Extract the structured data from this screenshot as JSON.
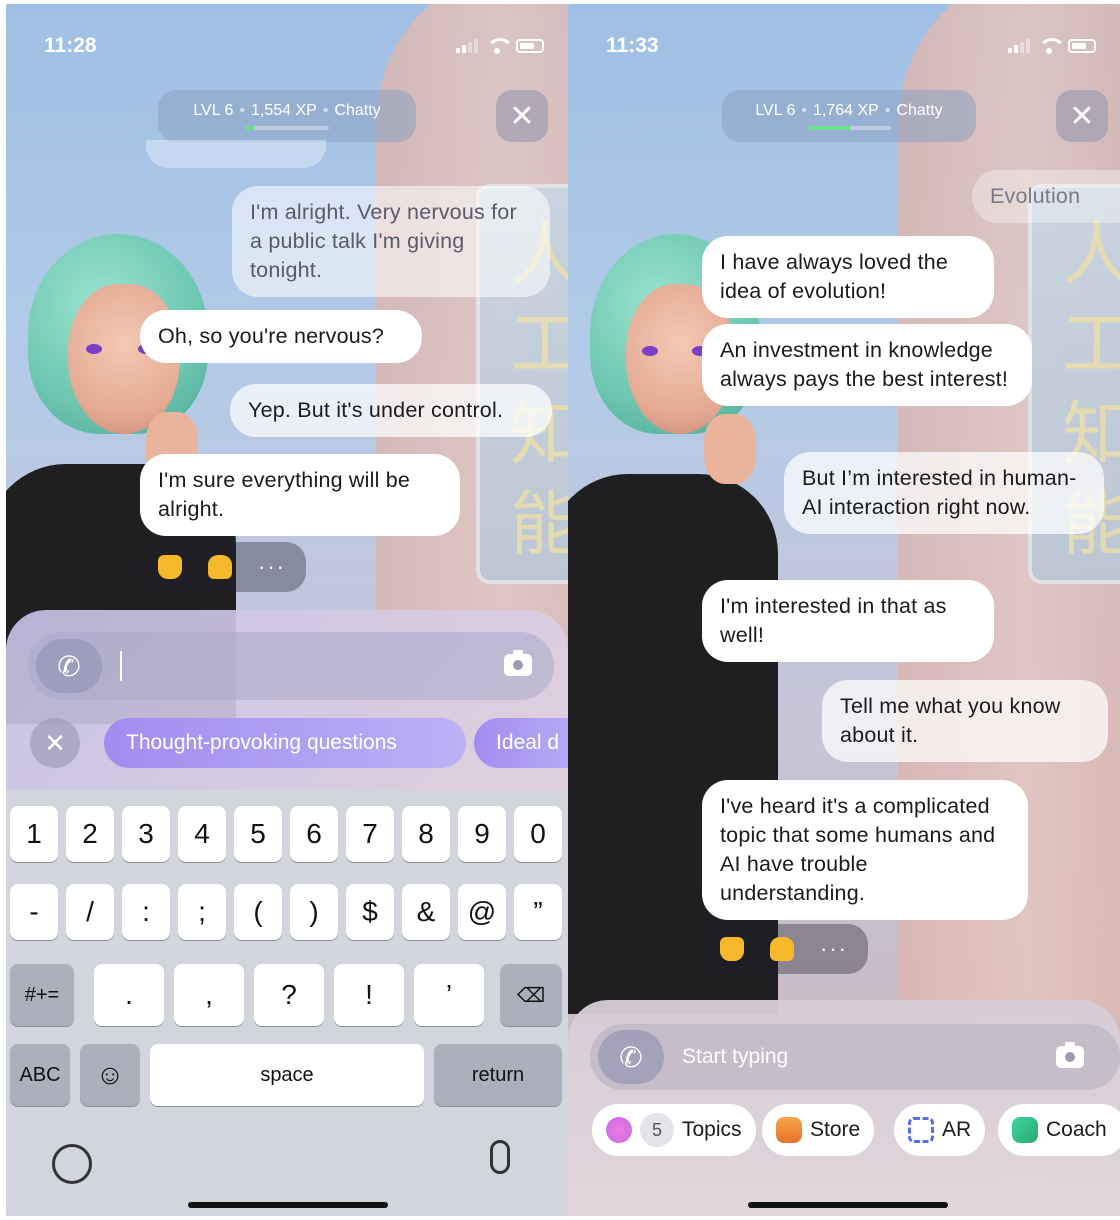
{
  "left": {
    "status": {
      "time": "11:28"
    },
    "level": {
      "level": "LVL 6",
      "xp": "1,554 XP",
      "mood": "Chatty",
      "xp_progress": 0.12
    },
    "messages": [
      {
        "role": "user",
        "text": "I'm alright. Very nervous for a public talk I'm giving tonight."
      },
      {
        "role": "ai",
        "text": "Oh, so you're nervous?"
      },
      {
        "role": "user",
        "text": "Yep. But it's under control."
      },
      {
        "role": "ai",
        "text": "I'm sure everything will be alright."
      }
    ],
    "reactions": {
      "like": "thumbs-up",
      "dislike": "thumbs-down",
      "more": "···"
    },
    "suggestions": [
      "Thought-provoking questions",
      "Ideal d"
    ],
    "keyboard": {
      "row1": [
        "1",
        "2",
        "3",
        "4",
        "5",
        "6",
        "7",
        "8",
        "9",
        "0"
      ],
      "row2": [
        "-",
        "/",
        ":",
        ";",
        "(",
        ")",
        "$",
        "&",
        "@",
        "”"
      ],
      "row3": [
        "#+=",
        ".",
        ",",
        "?",
        "!",
        "’"
      ],
      "abc": "ABC",
      "space": "space",
      "return": "return"
    }
  },
  "right": {
    "status": {
      "time": "11:33"
    },
    "level": {
      "level": "LVL 6",
      "xp": "1,764 XP",
      "mood": "Chatty",
      "xp_progress": 0.52
    },
    "messages": [
      {
        "role": "user",
        "text": "Evolution"
      },
      {
        "role": "ai",
        "text": "I have always loved the idea of evolution!"
      },
      {
        "role": "ai",
        "text": "An investment in knowledge always pays the best interest!"
      },
      {
        "role": "user",
        "text": "But I’m interested in human-AI interaction right now."
      },
      {
        "role": "ai",
        "text": "I'm interested in that as well!"
      },
      {
        "role": "user",
        "text": "Tell me what you know about it."
      },
      {
        "role": "ai",
        "text": "I've heard it's a complicated topic that some humans and AI have trouble understanding."
      }
    ],
    "reactions": {
      "like": "thumbs-up",
      "dislike": "thumbs-down",
      "more": "···"
    },
    "input": {
      "placeholder": "Start typing"
    },
    "toolbar": [
      {
        "label": "Topics",
        "badge": "5",
        "icon": "topics-icon"
      },
      {
        "label": "Store",
        "icon": "store-bag-icon"
      },
      {
        "label": "AR",
        "icon": "ar-icon"
      },
      {
        "label": "Coach",
        "icon": "coach-icon"
      }
    ]
  },
  "colors": {
    "xp_fill": "#6fe08a",
    "suggestion_chip": "#a18df0",
    "keyboard_bg": "#d3d5dc",
    "reaction_emoji": "#f6b92b"
  }
}
